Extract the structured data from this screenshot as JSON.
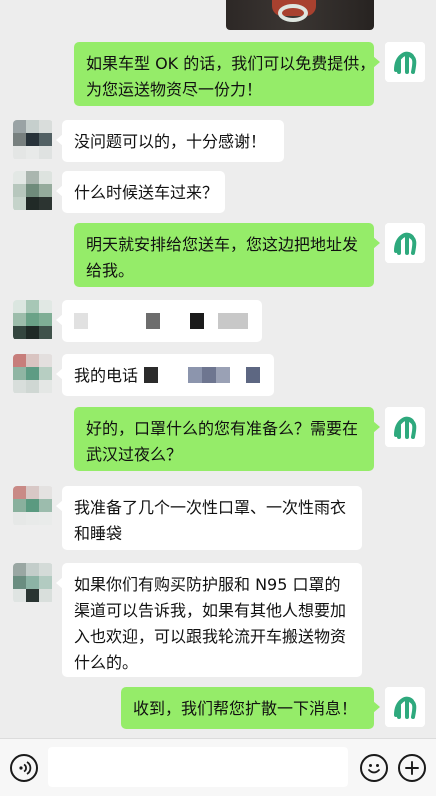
{
  "messages": [
    {
      "text": "如果车型OK的话，我们可以免费提供，为您运送物资尽一份力！",
      "lines": [
        "如果车型 OK 的话，我们可以免费提供，",
        "为您运送物资尽一份力！"
      ]
    },
    {
      "text": "没问题可以的，十分感谢！"
    },
    {
      "text": "什么时候送车过来？"
    },
    {
      "text": "明天就安排给您送车，您这边把地址发给我。",
      "lines": [
        "明天就安排给您送车，您这边把地址发",
        "给我。"
      ]
    },
    {
      "text": "",
      "redacted": true
    },
    {
      "text": "我的电话",
      "prefix": "我的电话"
    },
    {
      "text": "好的，口罩什么的您有准备么？需要在武汉过夜么？",
      "lines": [
        "好的，口罩什么的您有准备么？需要在",
        "武汉过夜么？"
      ]
    },
    {
      "text": "我准备了几个一次性口罩、一次性雨衣和睡袋",
      "lines": [
        "我准备了几个一次性口罩、一次性雨衣",
        "和睡袋"
      ]
    },
    {
      "text": "如果你们有购买防护服和N95口罩的渠道可以告诉我，如果有其他人想要加入也欢迎，可以跟我轮流开车搬送物资什么的。",
      "lines": [
        "如果你们有购买防护服和 N95 口罩的",
        "渠道可以告诉我，如果有其他人想要加",
        "入也欢迎，可以跟我轮流开车搬送物资",
        "什么的。"
      ]
    },
    {
      "text": "收到，我们帮您扩散一下消息！"
    }
  ],
  "input": {
    "value": "",
    "placeholder": ""
  },
  "icons": {
    "voice": "voice-icon",
    "emoji": "emoji-icon",
    "plus": "plus-icon",
    "my_avatar": "logo-avatar"
  },
  "colors": {
    "outgoing_bubble": "#95ec69",
    "incoming_bubble": "#ffffff",
    "background": "#ededed",
    "logo_green": "#2ea97d"
  }
}
